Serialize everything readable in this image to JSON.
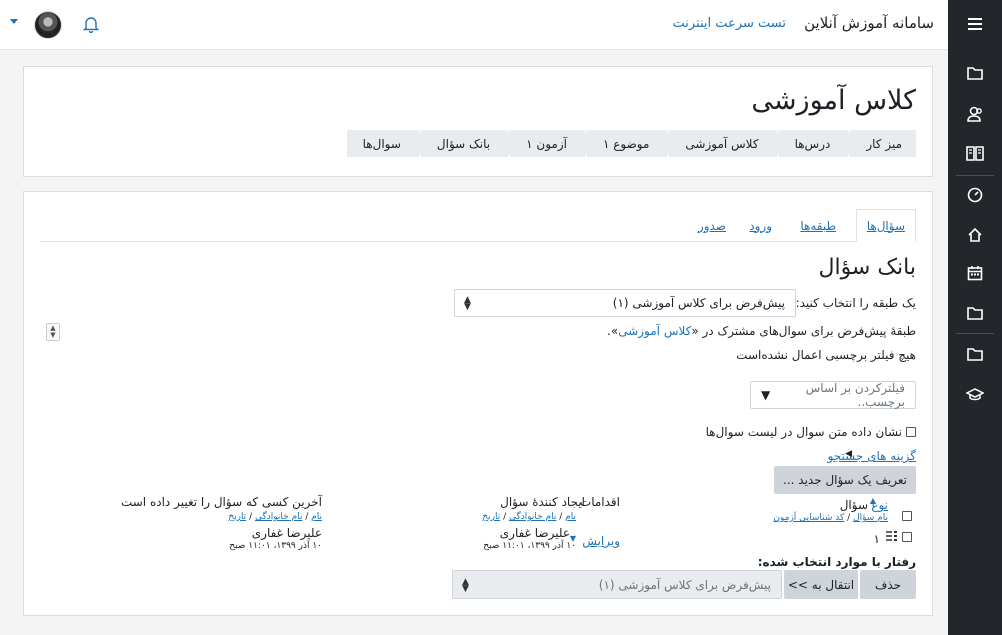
{
  "topbar": {
    "site_name": "سامانه آموزش آنلاین",
    "speed_test": "تست سرعت اینترنت"
  },
  "rail": {
    "icons": [
      "menu-icon",
      "folder-icon",
      "users-icon",
      "book-icon",
      "dashboard-icon",
      "home-icon",
      "calendar-icon",
      "folder-icon",
      "folder-icon",
      "graduation-cap-icon"
    ]
  },
  "header": {
    "title": "کلاس آموزشی",
    "breadcrumb": [
      "میز کار",
      "درس‌ها",
      "کلاس آموزشی",
      "موضوع ۱",
      "آزمون ۱",
      "بانک سؤال",
      "سوال‌ها"
    ]
  },
  "tabs": [
    {
      "label": "سؤال‌ها",
      "active": true
    },
    {
      "label": "طبقه‌ها",
      "active": false
    },
    {
      "label": "ورود",
      "active": false
    },
    {
      "label": "صدور",
      "active": false
    }
  ],
  "bank": {
    "heading": "بانک سؤال",
    "category_label": "یک طبقه را انتخاب کنید:",
    "category_value": "پیش‌فرض برای کلاس آموزشی (۱)",
    "category_desc_prefix": "طبقهٔ پیش‌فرض برای سوال‌های مشترک در «",
    "category_desc_link": "کلاس آموزشی",
    "category_desc_suffix": "».",
    "no_filter": "هیچ فیلتر برچسبی اعمال نشده‌است",
    "tag_filter_placeholder": "فیلترکردن بر اساس برچسب..",
    "show_text_label": "نشان داده متن سوال در لیست سوال‌ها",
    "search_options": "گزینه های جستجو",
    "create_button": "تعریف یک سؤال جدید ..."
  },
  "table": {
    "col_type": "نوع",
    "col_question": "سؤال",
    "sub_name": "نام سؤال",
    "sub_id": "کد شناسایی آزمون",
    "col_actions": "اقدامات",
    "col_created": "ایجاد کنندهٔ سؤال",
    "col_modified": "آخرین کسی که سؤال را تغییر داده است",
    "sort_first": "نام",
    "sort_last": "نام خانوادگی",
    "sort_date": "تاریخ",
    "row": {
      "name": "۱",
      "edit": "ویرایش",
      "creator": "علیرضا غفاری",
      "created_date": "۱۰ آذر ۱۳۹۹، ۱۱:۰۱ صبح",
      "modifier": "علیرضا غفاری",
      "modified_date": "۱۰ آذر ۱۳۹۹، ۱۱:۰۱ صبح"
    }
  },
  "bulk": {
    "label": "رفتار با موارد انتخاب شده:",
    "delete": "حذف",
    "move": "انتقال به >>",
    "target": "پیش‌فرض برای کلاس آموزشی (۱)"
  }
}
